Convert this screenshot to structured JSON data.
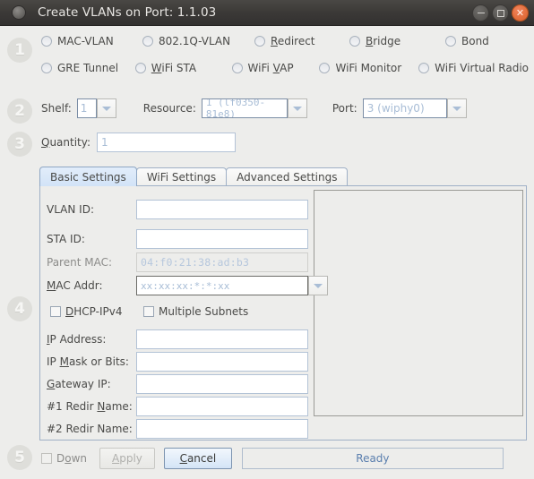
{
  "window": {
    "title": "Create VLANs on Port: 1.1.03",
    "icon": "app-dot-icon",
    "buttons": {
      "minimize": "minimize-icon",
      "maximize": "maximize-icon",
      "close": "close-icon"
    }
  },
  "steps": {
    "one": "1",
    "two": "2",
    "three": "3",
    "four": "4",
    "five": "5"
  },
  "port_types": {
    "row1": [
      {
        "label": "MAC-VLAN",
        "mnemonic": "",
        "selected": false
      },
      {
        "label": "802.1Q-VLAN",
        "mnemonic": "",
        "selected": false
      },
      {
        "label": "Redirect",
        "mnemonic": "R",
        "selected": false
      },
      {
        "label": "Bridge",
        "mnemonic": "B",
        "selected": false
      },
      {
        "label": "Bond",
        "mnemonic": "",
        "selected": false
      }
    ],
    "row2": [
      {
        "label": "GRE Tunnel",
        "mnemonic": "",
        "selected": false
      },
      {
        "label": "WiFi STA",
        "mnemonic": "W",
        "selected": false
      },
      {
        "label": "WiFi VAP",
        "mnemonic": "V",
        "selected": false
      },
      {
        "label": "WiFi Monitor",
        "mnemonic": "",
        "selected": false
      },
      {
        "label": "WiFi Virtual Radio",
        "mnemonic": "",
        "selected": false
      }
    ]
  },
  "location": {
    "shelf_label": "Shelf:",
    "shelf_value": "1",
    "resource_label": "Resource:",
    "resource_value": "1 (lf0350-81e8)",
    "port_label": "Port:",
    "port_value": "3 (wiphy0)"
  },
  "quantity": {
    "label": "Quantity:",
    "label_mnemonic": "Q",
    "value": "1"
  },
  "tabs": [
    {
      "label": "Basic Settings",
      "active": true
    },
    {
      "label": "WiFi Settings",
      "active": false
    },
    {
      "label": "Advanced Settings",
      "active": false
    }
  ],
  "basic_settings": {
    "vlan_id": {
      "label": "VLAN ID:",
      "value": ""
    },
    "sta_id": {
      "label": "STA ID:",
      "value": ""
    },
    "parent_mac": {
      "label": "Parent MAC:",
      "value": "04:f0:21:38:ad:b3"
    },
    "mac_addr": {
      "label": "MAC Addr:",
      "label_mnemonic": "M",
      "value": "xx:xx:xx:*:*:xx"
    },
    "dhcp_ipv4": {
      "label": "DHCP-IPv4",
      "label_mnemonic": "D",
      "checked": false
    },
    "multiple_subnets": {
      "label": "Multiple Subnets",
      "checked": false
    },
    "ip_address": {
      "label": "IP Address:",
      "label_mnemonic": "I",
      "value": ""
    },
    "ip_mask": {
      "label": "IP Mask or Bits:",
      "label_mnemonic": "M",
      "value": ""
    },
    "gateway_ip": {
      "label": "Gateway IP:",
      "label_mnemonic": "G",
      "value": ""
    },
    "redir1": {
      "label": "#1 Redir Name:",
      "label_mnemonic": "N",
      "value": ""
    },
    "redir2": {
      "label": "#2 Redir Name:",
      "value": ""
    }
  },
  "footer": {
    "down": {
      "label": "Down",
      "label_mnemonic": "o",
      "checked": false,
      "enabled": false
    },
    "apply": {
      "label": "Apply",
      "enabled": false
    },
    "cancel": {
      "label": "Cancel",
      "enabled": true
    },
    "status": "Ready"
  },
  "colors": {
    "window_bg": "#ededeb",
    "titlebar": "#3b3937",
    "close_button": "#e4703f",
    "field_border": "#b3c3d6",
    "placeholder_text": "#a8bdd6",
    "tab_active": "#d2e3f7",
    "status_text": "#5b7fae",
    "step_circle": "#dededa"
  }
}
